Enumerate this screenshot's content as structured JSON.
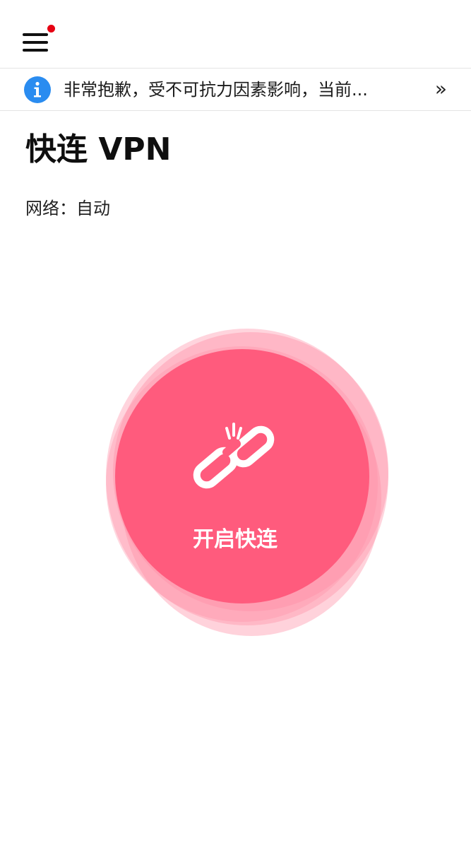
{
  "header": {
    "menu_icon": "hamburger-menu-icon",
    "has_notification": true
  },
  "notice": {
    "icon": "info-icon",
    "text": "非常抱歉，受不可抗力因素影响，当前...",
    "more": "»"
  },
  "main": {
    "title": "快连 VPN",
    "network_label": "网络：",
    "network_value": "自动",
    "network_text": "网络：自动"
  },
  "connect": {
    "icon": "broken-link-icon",
    "label": "开启快连",
    "status": "disconnected"
  },
  "colors": {
    "accent": "#ff5b7d",
    "accent_light": "#ff8fa6",
    "notification_dot": "#e60012",
    "info_blue": "#2a8cf0"
  }
}
